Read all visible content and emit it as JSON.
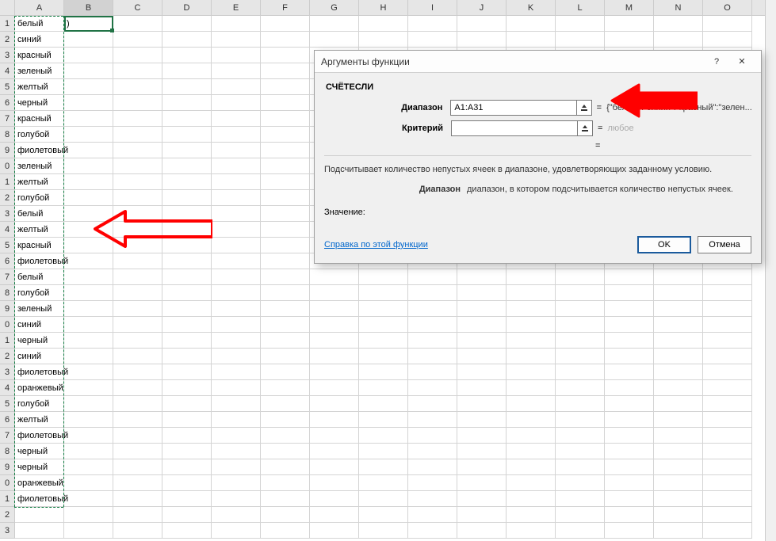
{
  "columns": [
    "A",
    "B",
    "C",
    "D",
    "E",
    "F",
    "G",
    "H",
    "I",
    "J",
    "K",
    "L",
    "M",
    "N",
    "O"
  ],
  "row_count": 33,
  "selected_column_index": 1,
  "active_cell_value": ")",
  "column_a": [
    "белый",
    "синий",
    "красный",
    "зеленый",
    "желтый",
    "черный",
    "красный",
    "голубой",
    "фиолетовый",
    "зеленый",
    "желтый",
    "голубой",
    "белый",
    "желтый",
    "красный",
    "фиолетовый",
    "белый",
    "голубой",
    "зеленый",
    "синий",
    "черный",
    "синий",
    "фиолетовый",
    "оранжевый",
    "голубой",
    "желтый",
    "фиолетовый",
    "черный",
    "черный",
    "оранжевый",
    "фиолетовый"
  ],
  "dialog": {
    "title": "Аргументы функции",
    "help_char": "?",
    "close_char": "✕",
    "function_name": "СЧЁТЕСЛИ",
    "args": [
      {
        "label": "Диапазон",
        "value": "A1:A31",
        "result": "{\"белый\":\"синий\":\"красный\":\"зелен...",
        "muted": false
      },
      {
        "label": "Критерий",
        "value": "",
        "result": "любое",
        "muted": true
      }
    ],
    "result_eq": "=",
    "description_main": "Подсчитывает количество непустых ячеек в диапазоне, удовлетворяющих заданному условию.",
    "description_arg_label": "Диапазон",
    "description_arg_text": "диапазон, в котором подсчитывается количество непустых ячеек.",
    "value_label": "Значение:",
    "help_link": "Справка по этой функции",
    "ok_label": "OK",
    "cancel_label": "Отмена"
  },
  "annotation": {
    "arrow_color": "#ff0000"
  }
}
